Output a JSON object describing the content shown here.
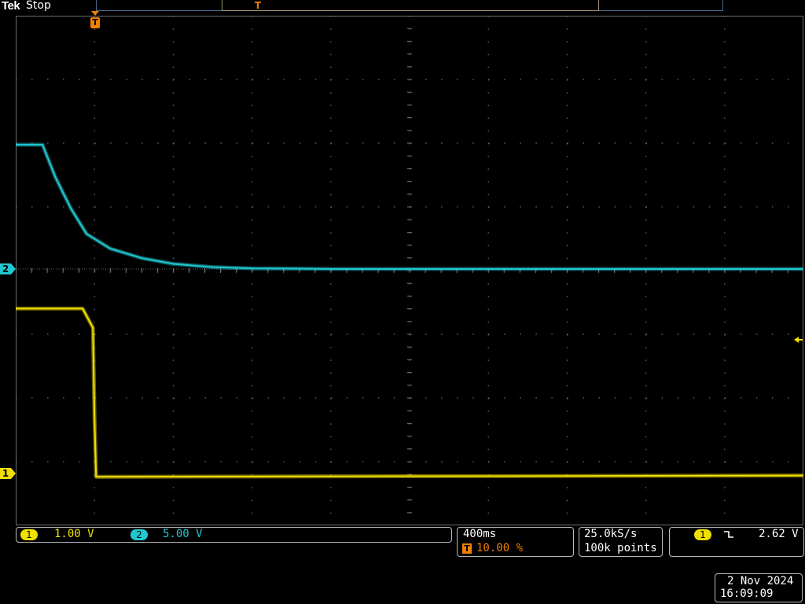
{
  "header": {
    "logo": "Tek",
    "run_state": "Stop"
  },
  "markers": {
    "trigger_position": "T",
    "record_view_marker": "T",
    "ch1_ground": "1",
    "ch2_ground": "2"
  },
  "status": {
    "ch1_badge": "1",
    "ch1_scale": "1.00 V",
    "ch2_badge": "2",
    "ch2_scale": "5.00 V",
    "timebase": "400ms",
    "trigger_badge": "T",
    "trigger_position": "10.00 %",
    "sample_rate": "25.0kS/s",
    "record_length": "100k points",
    "trigger_source_badge": "1",
    "trigger_slope_icon": "falling-edge-icon",
    "trigger_level": "2.62 V",
    "date": "2 Nov 2024",
    "time": "16:09:09"
  },
  "colors": {
    "ch1": "#f0e000",
    "ch2": "#20c8d0",
    "trigger": "#f08000",
    "grid": "#6e6e6e"
  },
  "chart_data": {
    "type": "line",
    "x_divisions": 10,
    "y_divisions": 8,
    "x_unit": "s",
    "timebase_per_div": 0.4,
    "series": [
      {
        "name": "1",
        "scale_per_div": 1.0,
        "x_div": [
          0,
          0.85,
          0.98,
          1.0,
          1.02,
          10
        ],
        "y_div_above_ground": [
          2.6,
          2.6,
          2.3,
          0.9,
          -0.04,
          -0.02
        ]
      },
      {
        "name": "2",
        "scale_per_div": 5.0,
        "x_div": [
          0,
          0.34,
          0.5,
          0.7,
          0.9,
          1.2,
          1.6,
          2.0,
          2.5,
          3.0,
          4.0,
          10
        ],
        "y_div_above_ground": [
          1.95,
          1.95,
          1.45,
          0.95,
          0.55,
          0.32,
          0.17,
          0.08,
          0.03,
          0.01,
          0.0,
          0.0
        ]
      }
    ]
  }
}
